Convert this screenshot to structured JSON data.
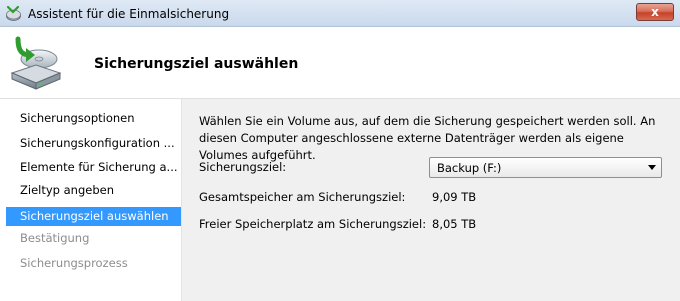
{
  "window": {
    "title": "Assistent für die Einmalsicherung",
    "close_label": "x"
  },
  "header": {
    "title": "Sicherungsziel auswählen"
  },
  "sidebar": {
    "items": [
      {
        "label": "Sicherungsoptionen",
        "state": "normal"
      },
      {
        "label": "Sicherungskonfiguration ...",
        "state": "normal"
      },
      {
        "label": "Elemente für Sicherung a...",
        "state": "normal"
      },
      {
        "label": "Zieltyp angeben",
        "state": "normal"
      },
      {
        "label": "Sicherungsziel auswählen",
        "state": "active"
      },
      {
        "label": "Bestätigung",
        "state": "disabled"
      },
      {
        "label": "Sicherungsprozess",
        "state": "disabled"
      }
    ]
  },
  "main": {
    "description": "Wählen Sie ein Volume aus, auf dem die Sicherung gespeichert werden soll. An diesen Computer angeschlossene externe Datenträger werden als eigene Volumes aufgeführt.",
    "target_label": "Sicherungsziel:",
    "target_value": "Backup (F:)",
    "total_label": "Gesamtspeicher am Sicherungsziel:",
    "total_value": "9,09 TB",
    "free_label": "Freier Speicherplatz am Sicherungsziel:",
    "free_value": "8,05 TB"
  },
  "colors": {
    "selection": "#3399ff",
    "content_bg": "#f0f0f0",
    "close_button": "#c5432b"
  },
  "icons": {
    "title": "backup-wizard-icon",
    "header": "backup-drive-icon"
  }
}
